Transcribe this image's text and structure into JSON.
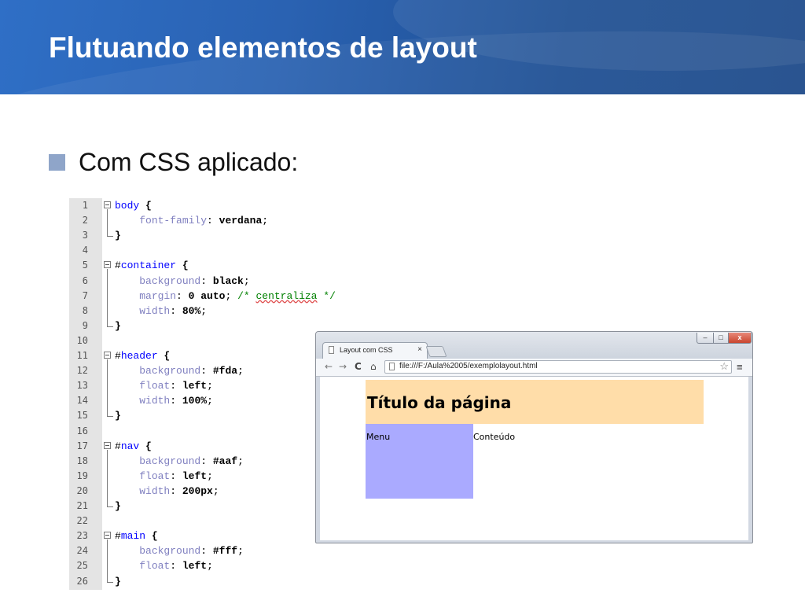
{
  "slide": {
    "title": "Flutuando elementos de layout",
    "bullet": "Com CSS aplicado:"
  },
  "colors": {
    "header_band": "#2a62b2",
    "bullet": "#8fa5c9",
    "page_header_bg": "#ffdda9",
    "page_nav_bg": "#aaaaff"
  },
  "editor": {
    "lines": [
      {
        "n": "1",
        "text": "body {"
      },
      {
        "n": "2",
        "text": "    font-family: verdana;"
      },
      {
        "n": "3",
        "text": "}"
      },
      {
        "n": "4",
        "text": ""
      },
      {
        "n": "5",
        "text": "#container {"
      },
      {
        "n": "6",
        "text": "    background: black;"
      },
      {
        "n": "7",
        "text": "    margin: 0 auto; /* centraliza */"
      },
      {
        "n": "8",
        "text": "    width: 80%;"
      },
      {
        "n": "9",
        "text": "}"
      },
      {
        "n": "10",
        "text": ""
      },
      {
        "n": "11",
        "text": "#header {"
      },
      {
        "n": "12",
        "text": "    background: #fda;"
      },
      {
        "n": "13",
        "text": "    float: left;"
      },
      {
        "n": "14",
        "text": "    width: 100%;"
      },
      {
        "n": "15",
        "text": "}"
      },
      {
        "n": "16",
        "text": ""
      },
      {
        "n": "17",
        "text": "#nav {"
      },
      {
        "n": "18",
        "text": "    background: #aaf;"
      },
      {
        "n": "19",
        "text": "    float: left;"
      },
      {
        "n": "20",
        "text": "    width: 200px;"
      },
      {
        "n": "21",
        "text": "}"
      },
      {
        "n": "22",
        "text": ""
      },
      {
        "n": "23",
        "text": "#main {"
      },
      {
        "n": "24",
        "text": "    background: #fff;"
      },
      {
        "n": "25",
        "text": "    float: left;"
      },
      {
        "n": "26",
        "text": "}"
      }
    ]
  },
  "browser": {
    "tab_title": "Layout com CSS",
    "tab_close": "×",
    "url": "file:///F:/Aula%2005/exemplolayout.html",
    "win_min": "–",
    "win_max": "□",
    "win_close": "x",
    "back_glyph": "←",
    "forward_glyph": "→",
    "reload_glyph": "C",
    "home_glyph": "⌂",
    "star_glyph": "☆",
    "menu_glyph": "≡",
    "page": {
      "title": "Título da página",
      "nav": "Menu",
      "main": "Conteúdo"
    }
  }
}
